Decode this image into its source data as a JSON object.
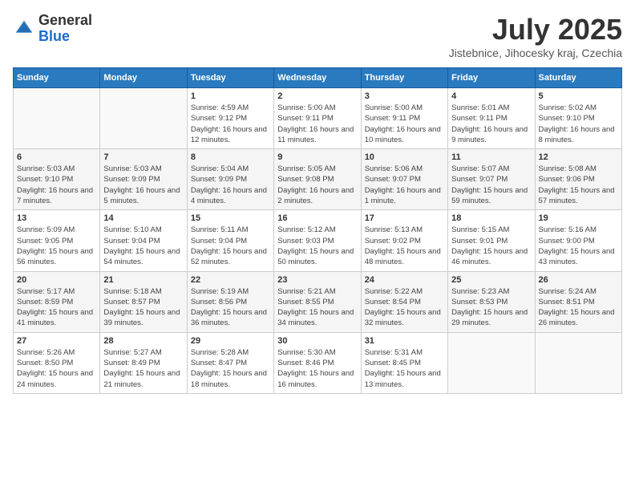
{
  "header": {
    "logo_general": "General",
    "logo_blue": "Blue",
    "month_year": "July 2025",
    "location": "Jistebnice, Jihocesky kraj, Czechia"
  },
  "weekdays": [
    "Sunday",
    "Monday",
    "Tuesday",
    "Wednesday",
    "Thursday",
    "Friday",
    "Saturday"
  ],
  "weeks": [
    [
      {
        "day": "",
        "info": ""
      },
      {
        "day": "",
        "info": ""
      },
      {
        "day": "1",
        "info": "Sunrise: 4:59 AM\nSunset: 9:12 PM\nDaylight: 16 hours and 12 minutes."
      },
      {
        "day": "2",
        "info": "Sunrise: 5:00 AM\nSunset: 9:11 PM\nDaylight: 16 hours and 11 minutes."
      },
      {
        "day": "3",
        "info": "Sunrise: 5:00 AM\nSunset: 9:11 PM\nDaylight: 16 hours and 10 minutes."
      },
      {
        "day": "4",
        "info": "Sunrise: 5:01 AM\nSunset: 9:11 PM\nDaylight: 16 hours and 9 minutes."
      },
      {
        "day": "5",
        "info": "Sunrise: 5:02 AM\nSunset: 9:10 PM\nDaylight: 16 hours and 8 minutes."
      }
    ],
    [
      {
        "day": "6",
        "info": "Sunrise: 5:03 AM\nSunset: 9:10 PM\nDaylight: 16 hours and 7 minutes."
      },
      {
        "day": "7",
        "info": "Sunrise: 5:03 AM\nSunset: 9:09 PM\nDaylight: 16 hours and 5 minutes."
      },
      {
        "day": "8",
        "info": "Sunrise: 5:04 AM\nSunset: 9:09 PM\nDaylight: 16 hours and 4 minutes."
      },
      {
        "day": "9",
        "info": "Sunrise: 5:05 AM\nSunset: 9:08 PM\nDaylight: 16 hours and 2 minutes."
      },
      {
        "day": "10",
        "info": "Sunrise: 5:06 AM\nSunset: 9:07 PM\nDaylight: 16 hours and 1 minute."
      },
      {
        "day": "11",
        "info": "Sunrise: 5:07 AM\nSunset: 9:07 PM\nDaylight: 15 hours and 59 minutes."
      },
      {
        "day": "12",
        "info": "Sunrise: 5:08 AM\nSunset: 9:06 PM\nDaylight: 15 hours and 57 minutes."
      }
    ],
    [
      {
        "day": "13",
        "info": "Sunrise: 5:09 AM\nSunset: 9:05 PM\nDaylight: 15 hours and 56 minutes."
      },
      {
        "day": "14",
        "info": "Sunrise: 5:10 AM\nSunset: 9:04 PM\nDaylight: 15 hours and 54 minutes."
      },
      {
        "day": "15",
        "info": "Sunrise: 5:11 AM\nSunset: 9:04 PM\nDaylight: 15 hours and 52 minutes."
      },
      {
        "day": "16",
        "info": "Sunrise: 5:12 AM\nSunset: 9:03 PM\nDaylight: 15 hours and 50 minutes."
      },
      {
        "day": "17",
        "info": "Sunrise: 5:13 AM\nSunset: 9:02 PM\nDaylight: 15 hours and 48 minutes."
      },
      {
        "day": "18",
        "info": "Sunrise: 5:15 AM\nSunset: 9:01 PM\nDaylight: 15 hours and 46 minutes."
      },
      {
        "day": "19",
        "info": "Sunrise: 5:16 AM\nSunset: 9:00 PM\nDaylight: 15 hours and 43 minutes."
      }
    ],
    [
      {
        "day": "20",
        "info": "Sunrise: 5:17 AM\nSunset: 8:59 PM\nDaylight: 15 hours and 41 minutes."
      },
      {
        "day": "21",
        "info": "Sunrise: 5:18 AM\nSunset: 8:57 PM\nDaylight: 15 hours and 39 minutes."
      },
      {
        "day": "22",
        "info": "Sunrise: 5:19 AM\nSunset: 8:56 PM\nDaylight: 15 hours and 36 minutes."
      },
      {
        "day": "23",
        "info": "Sunrise: 5:21 AM\nSunset: 8:55 PM\nDaylight: 15 hours and 34 minutes."
      },
      {
        "day": "24",
        "info": "Sunrise: 5:22 AM\nSunset: 8:54 PM\nDaylight: 15 hours and 32 minutes."
      },
      {
        "day": "25",
        "info": "Sunrise: 5:23 AM\nSunset: 8:53 PM\nDaylight: 15 hours and 29 minutes."
      },
      {
        "day": "26",
        "info": "Sunrise: 5:24 AM\nSunset: 8:51 PM\nDaylight: 15 hours and 26 minutes."
      }
    ],
    [
      {
        "day": "27",
        "info": "Sunrise: 5:26 AM\nSunset: 8:50 PM\nDaylight: 15 hours and 24 minutes."
      },
      {
        "day": "28",
        "info": "Sunrise: 5:27 AM\nSunset: 8:49 PM\nDaylight: 15 hours and 21 minutes."
      },
      {
        "day": "29",
        "info": "Sunrise: 5:28 AM\nSunset: 8:47 PM\nDaylight: 15 hours and 18 minutes."
      },
      {
        "day": "30",
        "info": "Sunrise: 5:30 AM\nSunset: 8:46 PM\nDaylight: 15 hours and 16 minutes."
      },
      {
        "day": "31",
        "info": "Sunrise: 5:31 AM\nSunset: 8:45 PM\nDaylight: 15 hours and 13 minutes."
      },
      {
        "day": "",
        "info": ""
      },
      {
        "day": "",
        "info": ""
      }
    ]
  ]
}
